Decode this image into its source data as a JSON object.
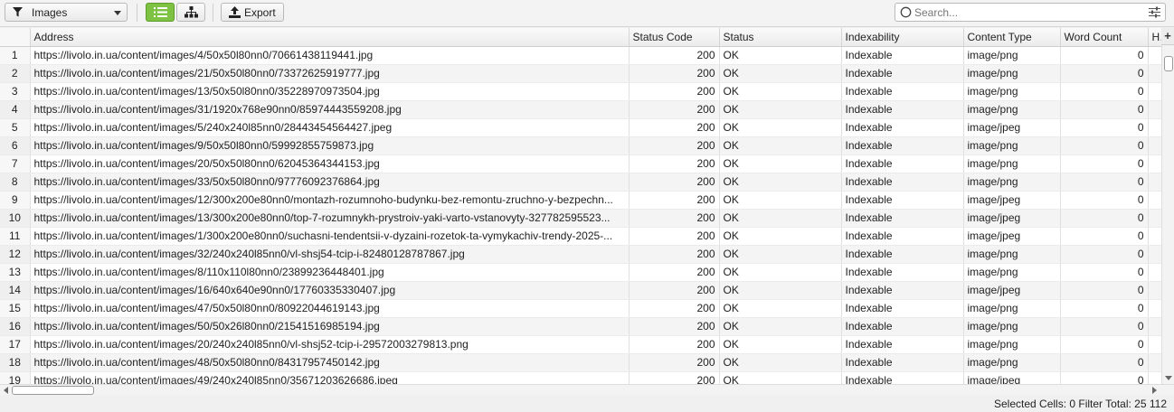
{
  "toolbar": {
    "filter_value": "Images",
    "export_label": "Export",
    "search_placeholder": "Search..."
  },
  "table": {
    "columns": [
      "Address",
      "Status Code",
      "Status",
      "Indexability",
      "Content Type",
      "Word Count",
      "H"
    ],
    "rows": [
      {
        "n": "1",
        "address": "https://livolo.in.ua/content/images/4/50x50l80nn0/70661438119441.jpg",
        "code": "200",
        "status": "OK",
        "index": "Indexable",
        "type": "image/png",
        "words": "0"
      },
      {
        "n": "2",
        "address": "https://livolo.in.ua/content/images/21/50x50l80nn0/73372625919777.jpg",
        "code": "200",
        "status": "OK",
        "index": "Indexable",
        "type": "image/png",
        "words": "0"
      },
      {
        "n": "3",
        "address": "https://livolo.in.ua/content/images/13/50x50l80nn0/35228970973504.jpg",
        "code": "200",
        "status": "OK",
        "index": "Indexable",
        "type": "image/png",
        "words": "0"
      },
      {
        "n": "4",
        "address": "https://livolo.in.ua/content/images/31/1920x768e90nn0/85974443559208.jpg",
        "code": "200",
        "status": "OK",
        "index": "Indexable",
        "type": "image/png",
        "words": "0"
      },
      {
        "n": "5",
        "address": "https://livolo.in.ua/content/images/5/240x240l85nn0/28443454564427.jpeg",
        "code": "200",
        "status": "OK",
        "index": "Indexable",
        "type": "image/jpeg",
        "words": "0"
      },
      {
        "n": "6",
        "address": "https://livolo.in.ua/content/images/9/50x50l80nn0/59992855759873.jpg",
        "code": "200",
        "status": "OK",
        "index": "Indexable",
        "type": "image/png",
        "words": "0"
      },
      {
        "n": "7",
        "address": "https://livolo.in.ua/content/images/20/50x50l80nn0/62045364344153.jpg",
        "code": "200",
        "status": "OK",
        "index": "Indexable",
        "type": "image/png",
        "words": "0"
      },
      {
        "n": "8",
        "address": "https://livolo.in.ua/content/images/33/50x50l80nn0/97776092376864.jpg",
        "code": "200",
        "status": "OK",
        "index": "Indexable",
        "type": "image/png",
        "words": "0"
      },
      {
        "n": "9",
        "address": "https://livolo.in.ua/content/images/12/300x200e80nn0/montazh-rozumnoho-budynku-bez-remontu-zruchno-y-bezpechn...",
        "code": "200",
        "status": "OK",
        "index": "Indexable",
        "type": "image/jpeg",
        "words": "0"
      },
      {
        "n": "10",
        "address": "https://livolo.in.ua/content/images/13/300x200e80nn0/top-7-rozumnykh-prystroiv-yaki-varto-vstanovyty-327782595523...",
        "code": "200",
        "status": "OK",
        "index": "Indexable",
        "type": "image/jpeg",
        "words": "0"
      },
      {
        "n": "11",
        "address": "https://livolo.in.ua/content/images/1/300x200e80nn0/suchasni-tendentsii-v-dyzaini-rozetok-ta-vymykachiv-trendy-2025-...",
        "code": "200",
        "status": "OK",
        "index": "Indexable",
        "type": "image/jpeg",
        "words": "0"
      },
      {
        "n": "12",
        "address": "https://livolo.in.ua/content/images/32/240x240l85nn0/vl-shsj54-tcip-i-82480128787867.jpg",
        "code": "200",
        "status": "OK",
        "index": "Indexable",
        "type": "image/png",
        "words": "0"
      },
      {
        "n": "13",
        "address": "https://livolo.in.ua/content/images/8/110x110l80nn0/23899236448401.jpg",
        "code": "200",
        "status": "OK",
        "index": "Indexable",
        "type": "image/png",
        "words": "0"
      },
      {
        "n": "14",
        "address": "https://livolo.in.ua/content/images/16/640x640e90nn0/17760335330407.jpg",
        "code": "200",
        "status": "OK",
        "index": "Indexable",
        "type": "image/jpeg",
        "words": "0"
      },
      {
        "n": "15",
        "address": "https://livolo.in.ua/content/images/47/50x50l80nn0/80922044619143.jpg",
        "code": "200",
        "status": "OK",
        "index": "Indexable",
        "type": "image/png",
        "words": "0"
      },
      {
        "n": "16",
        "address": "https://livolo.in.ua/content/images/50/50x26l80nn0/21541516985194.jpg",
        "code": "200",
        "status": "OK",
        "index": "Indexable",
        "type": "image/png",
        "words": "0"
      },
      {
        "n": "17",
        "address": "https://livolo.in.ua/content/images/20/240x240l85nn0/vl-shsj52-tcip-i-29572003279813.png",
        "code": "200",
        "status": "OK",
        "index": "Indexable",
        "type": "image/png",
        "words": "0"
      },
      {
        "n": "18",
        "address": "https://livolo.in.ua/content/images/48/50x50l80nn0/84317957450142.jpg",
        "code": "200",
        "status": "OK",
        "index": "Indexable",
        "type": "image/png",
        "words": "0"
      },
      {
        "n": "19",
        "address": "https://livolo.in.ua/content/images/49/240x240l85nn0/35671203626686.jpeg",
        "code": "200",
        "status": "OK",
        "index": "Indexable",
        "type": "image/jpeg",
        "words": "0"
      }
    ]
  },
  "statusbar": {
    "text": "Selected Cells:  0  Filter Total:  25 112"
  }
}
